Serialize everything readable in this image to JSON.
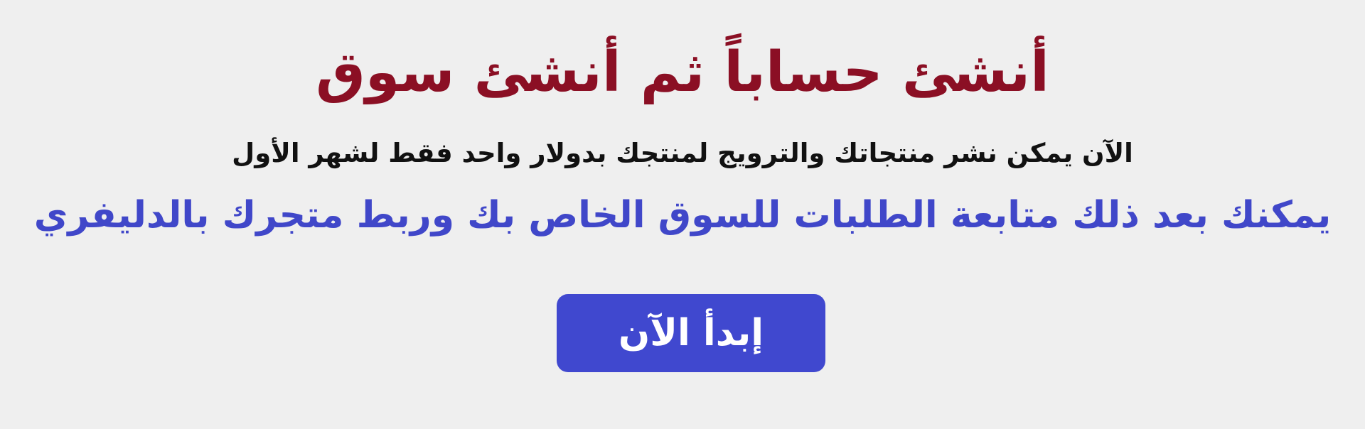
{
  "hero": {
    "title": "أنشئ حساباً ثم أنشئ سوق",
    "subtitle": "الآن يمكن نشر منتجاتك والترويج لمنتجك بدولار واحد فقط لشهر الأول",
    "highlight": "يمكنك بعد ذلك متابعة الطلبات للسوق الخاص بك وربط متجرك بالدليفري",
    "button_label": "إبدأ الآن"
  },
  "colors": {
    "background": "#efefef",
    "title": "#8b0f24",
    "subtitle": "#111111",
    "highlight": "#4047c9",
    "button": "#4048cf",
    "button_text": "#ffffff"
  }
}
